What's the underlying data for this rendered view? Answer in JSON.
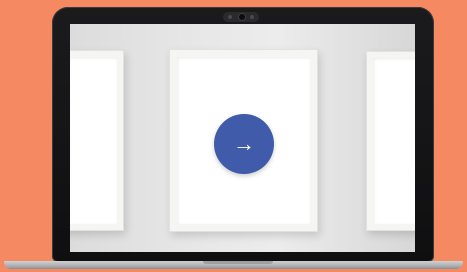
{
  "device": {
    "type": "laptop"
  },
  "slideshow": {
    "next_button": {
      "icon": "arrow-right-icon",
      "glyph": "→"
    }
  },
  "colors": {
    "background": "#F58A62",
    "button": "#3F5BAA",
    "screen": "#E8E8E8",
    "frame": "#F5F5F4"
  }
}
